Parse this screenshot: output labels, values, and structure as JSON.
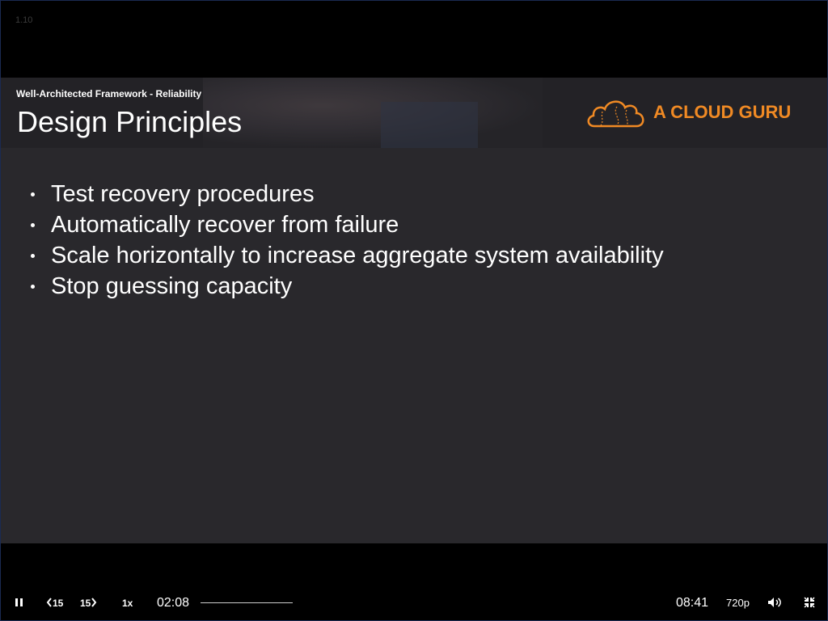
{
  "player": {
    "version": "1.10"
  },
  "slide": {
    "subtitle": "Well-Architected Framework - Reliability",
    "title": "Design Principles",
    "logo_text": "A CLOUD GURU",
    "bullets": [
      "Test recovery procedures",
      "Automatically recover from failure",
      "Scale horizontally to increase aggregate system availability",
      "Stop guessing capacity"
    ]
  },
  "controls": {
    "skip_back_label": "15",
    "skip_forward_label": "15",
    "speed_label": "1x",
    "current_time": "02:08",
    "total_time": "08:41",
    "quality_label": "720p",
    "progress_fraction": 0.245
  },
  "colors": {
    "brand_orange": "#f08a24",
    "slide_background": "#29282c",
    "header_background": "#232226"
  },
  "icons": {
    "pause": "pause-icon",
    "skip_back": "skip-back-icon",
    "skip_forward": "skip-forward-icon",
    "volume": "volume-icon",
    "fullscreen_exit": "fullscreen-exit-icon",
    "logo": "cloud-logo-icon"
  }
}
